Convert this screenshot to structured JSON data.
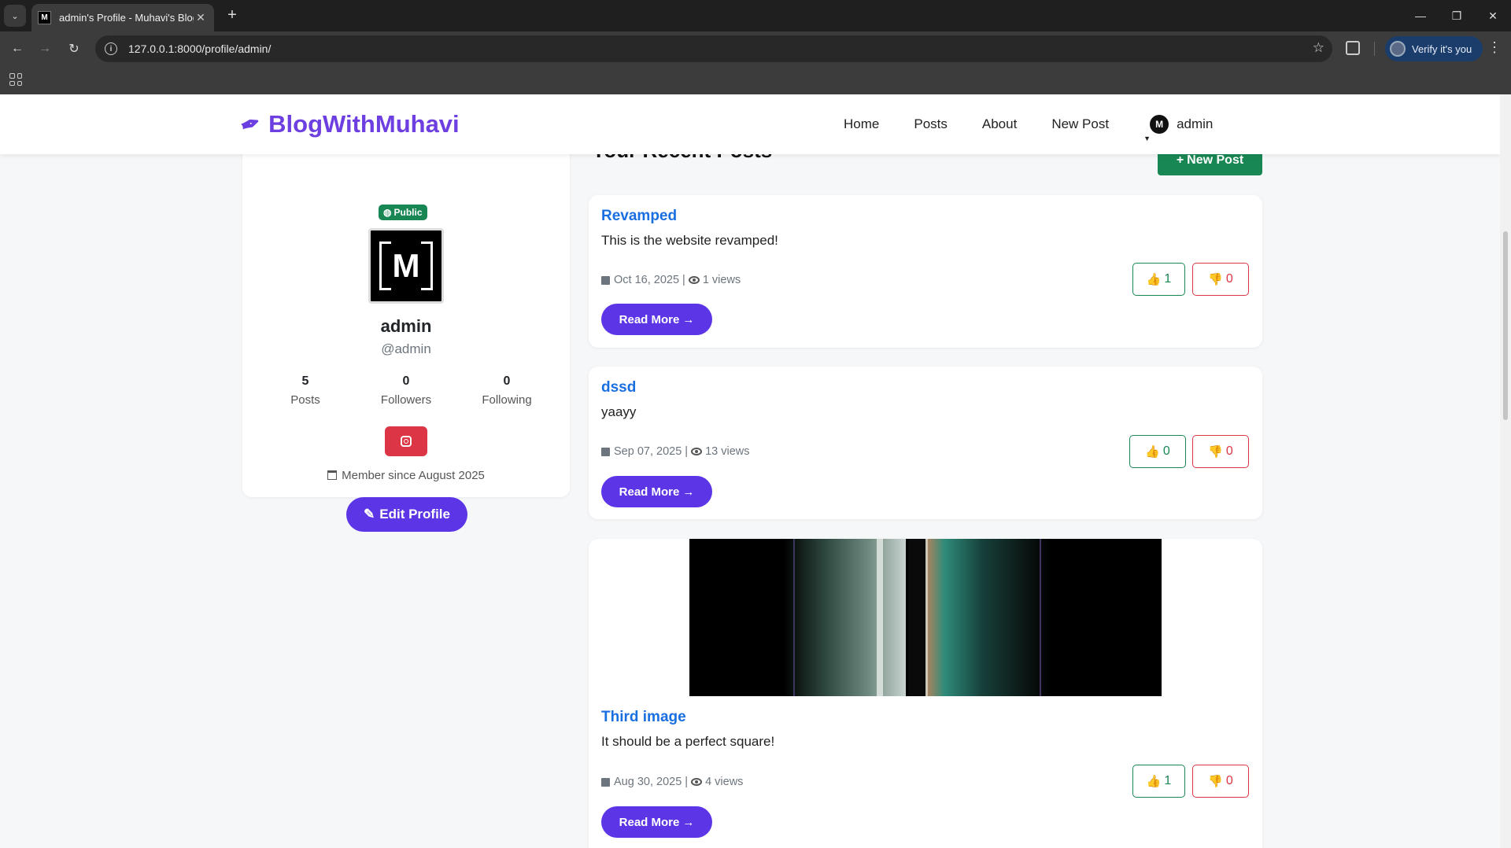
{
  "browser": {
    "tab_title": "admin's Profile - Muhavi's Blog",
    "tab_favicon_letter": "M",
    "url": "127.0.0.1:8000/profile/admin/",
    "verify_label": "Verify it's you"
  },
  "navbar": {
    "brand": "BlogWithMuhavi",
    "links": [
      "Home",
      "Posts",
      "About",
      "New Post"
    ],
    "user": "admin",
    "user_avatar_letter": "M"
  },
  "profile": {
    "visibility_badge": "Public",
    "avatar_letter": "M",
    "name": "admin",
    "handle": "@admin",
    "stats": [
      {
        "value": "5",
        "label": "Posts"
      },
      {
        "value": "0",
        "label": "Followers"
      },
      {
        "value": "0",
        "label": "Following"
      }
    ],
    "member_since": "Member since August 2025",
    "edit_button": "Edit Profile"
  },
  "posts_section": {
    "heading": "Your Recent Posts",
    "new_post_button": "New Post",
    "read_more_label": "Read More",
    "posts": [
      {
        "title": "Revamped",
        "excerpt": "This is the website revamped!",
        "date": "Oct 16, 2025",
        "views": "1 views",
        "likes": "1",
        "dislikes": "0"
      },
      {
        "title": "dssd",
        "excerpt": "yaayy",
        "date": "Sep 07, 2025",
        "views": "13 views",
        "likes": "0",
        "dislikes": "0"
      },
      {
        "title": "Third image",
        "excerpt": "It should be a perfect square!",
        "date": "Aug 30, 2025",
        "views": "4 views",
        "likes": "1",
        "dislikes": "0"
      }
    ]
  },
  "icons": {
    "brand": "pen-nib-icon",
    "globe": "globe-icon",
    "instagram": "instagram-icon",
    "calendar": "calendar-icon",
    "eye": "eye-icon",
    "thumbs_up": "thumbs-up-icon",
    "thumbs_down": "thumbs-down-icon"
  },
  "colors": {
    "brand_purple": "#6d3fe0",
    "button_purple": "#5b35e6",
    "success_green": "#198754",
    "danger_red": "#dc3545",
    "link_blue": "#1a6fe0"
  }
}
